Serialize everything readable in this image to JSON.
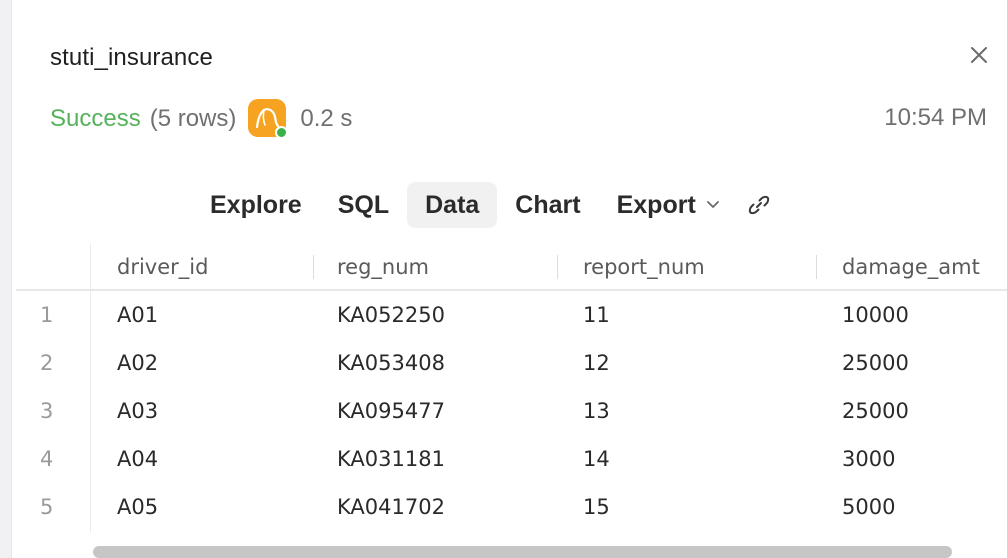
{
  "panel": {
    "title": "stuti_insurance",
    "status": "Success",
    "row_count_text": "(5 rows)",
    "duration": "0.2 s",
    "time": "10:54 PM",
    "db_icon": "mysql-dolphin-icon",
    "accent_color": "#55b25a",
    "db_icon_color": "#f5a320",
    "status_dot_color": "#3bb249"
  },
  "tabs": [
    {
      "label": "Explore",
      "active": false
    },
    {
      "label": "SQL",
      "active": false
    },
    {
      "label": "Data",
      "active": true
    },
    {
      "label": "Chart",
      "active": false
    },
    {
      "label": "Export",
      "active": false
    }
  ],
  "table": {
    "columns": [
      "driver_id",
      "reg_num",
      "report_num",
      "damage_amt"
    ],
    "rows": [
      {
        "n": "1",
        "cells": [
          "A01",
          "KA052250",
          "11",
          "10000"
        ]
      },
      {
        "n": "2",
        "cells": [
          "A02",
          "KA053408",
          "12",
          "25000"
        ]
      },
      {
        "n": "3",
        "cells": [
          "A03",
          "KA095477",
          "13",
          "25000"
        ]
      },
      {
        "n": "4",
        "cells": [
          "A04",
          "KA031181",
          "14",
          "3000"
        ]
      },
      {
        "n": "5",
        "cells": [
          "A05",
          "KA041702",
          "15",
          "5000"
        ]
      }
    ]
  }
}
